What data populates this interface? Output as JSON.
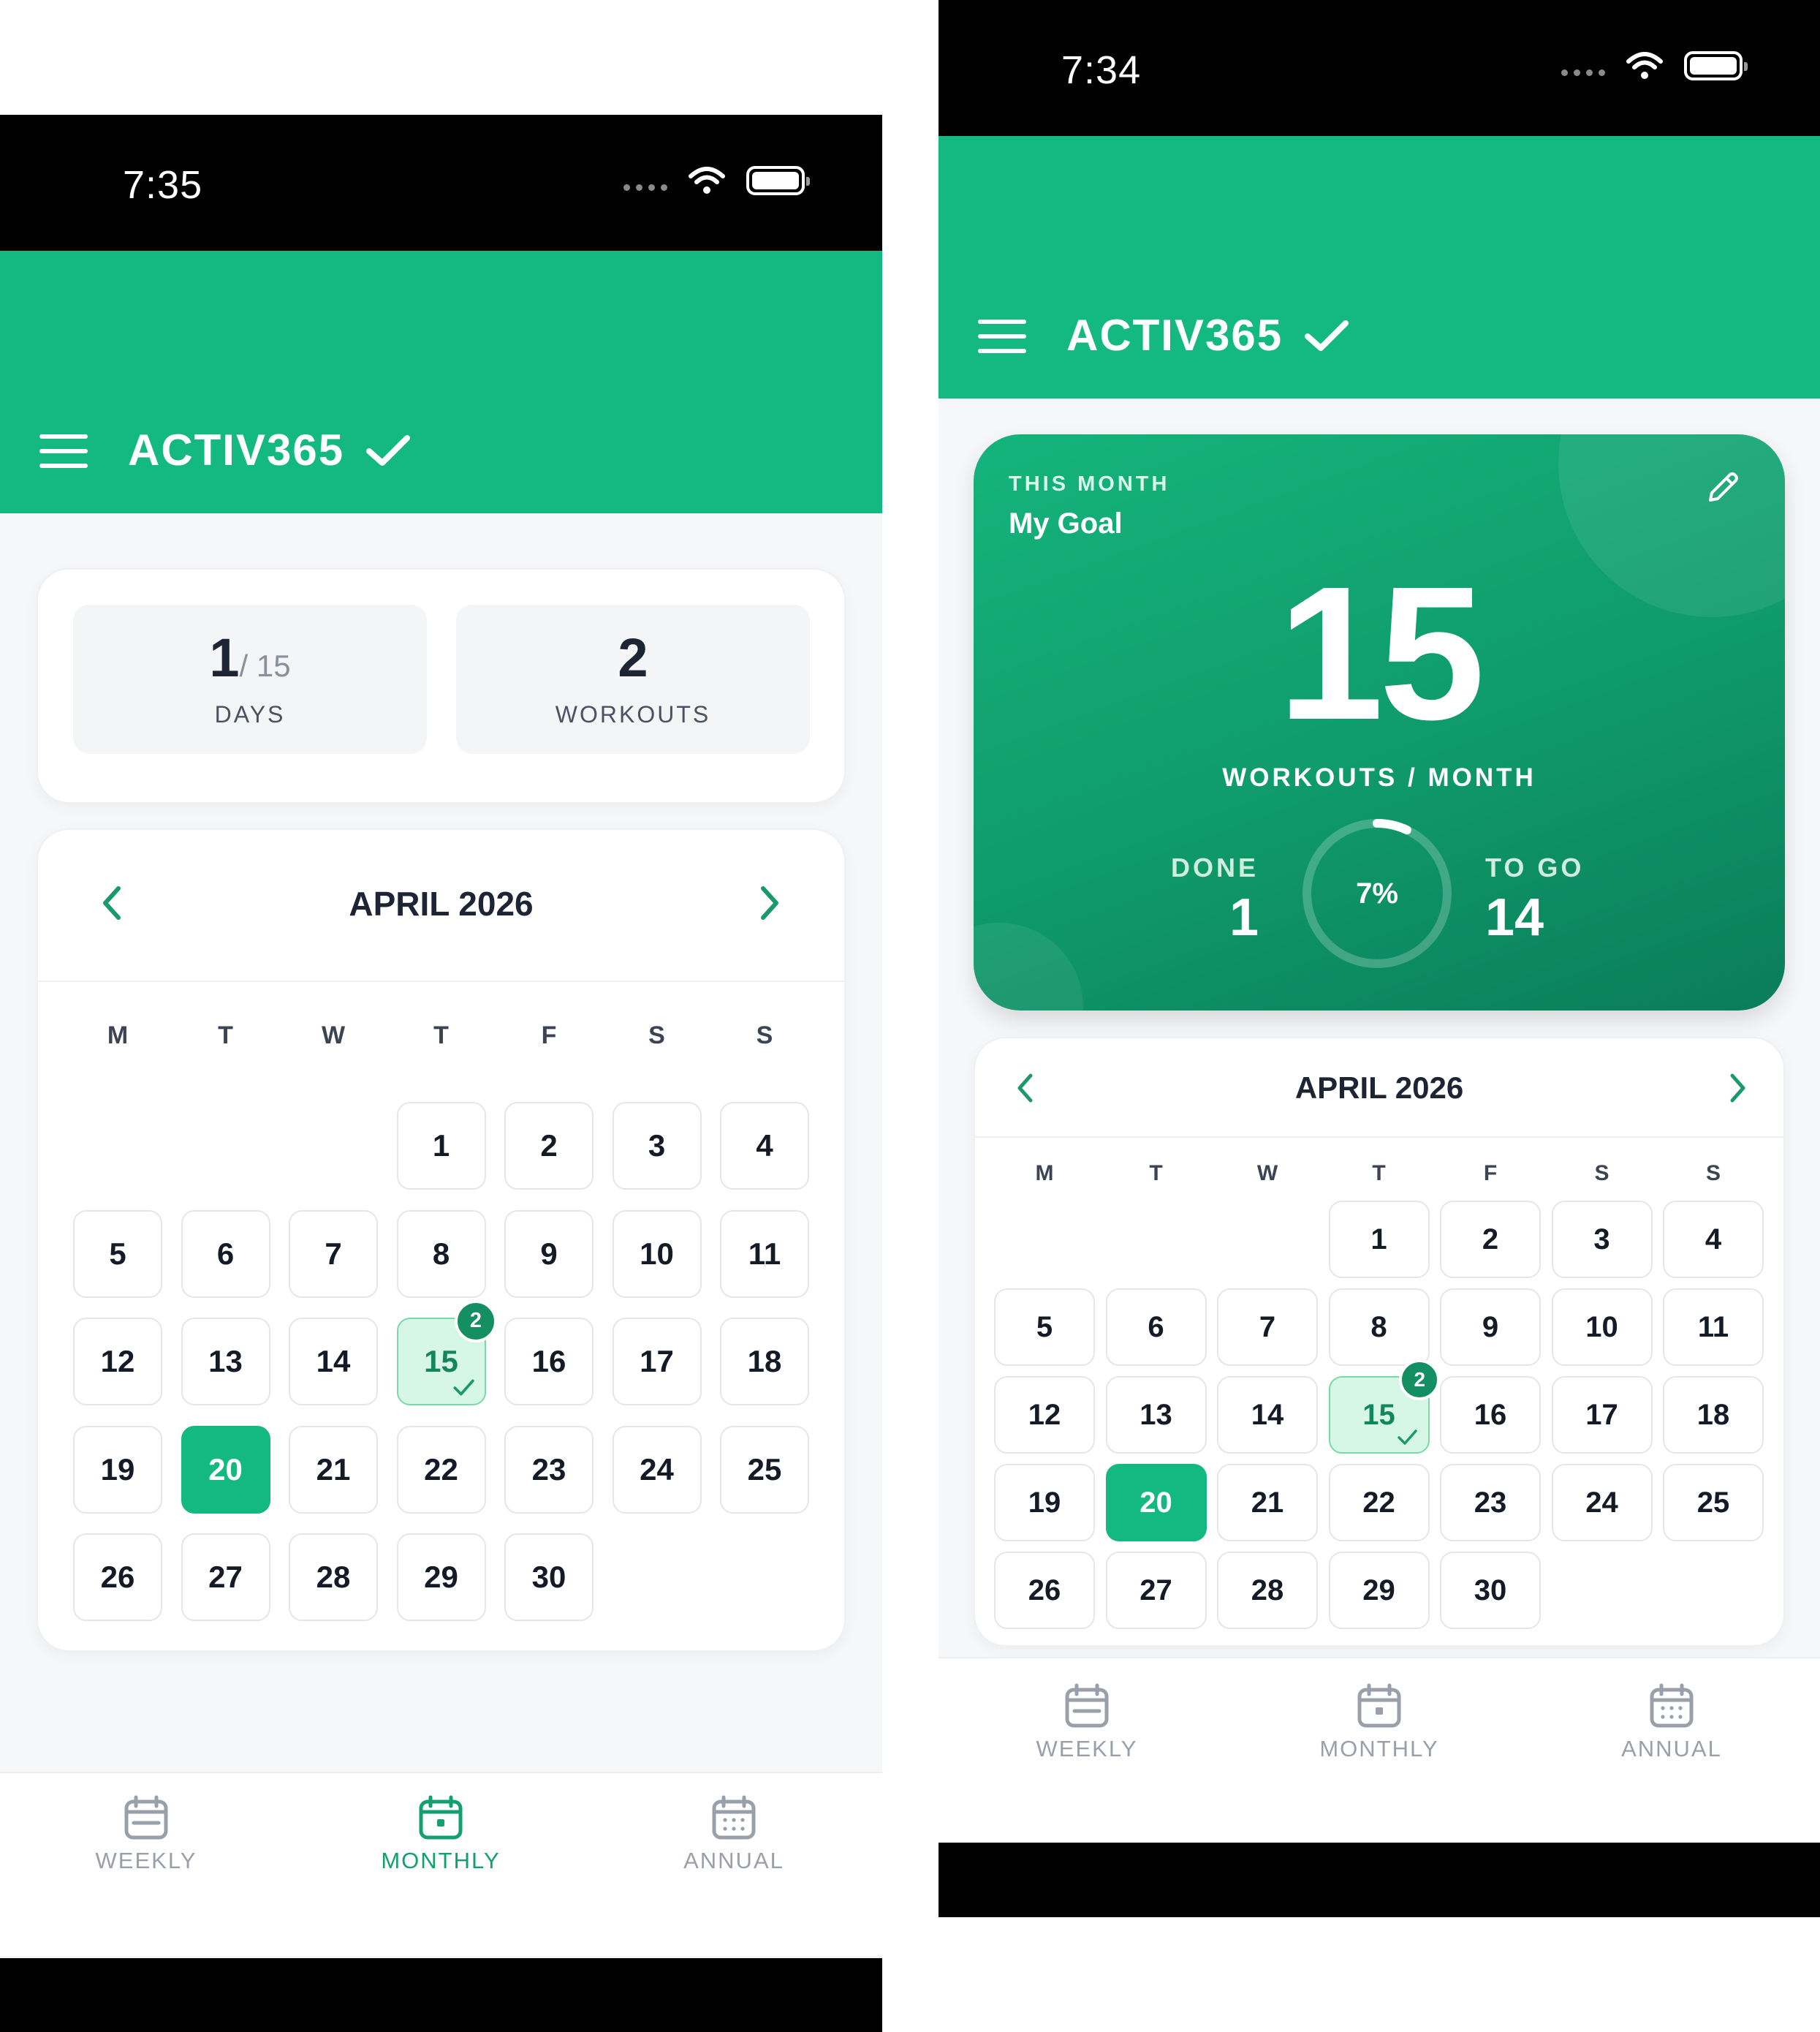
{
  "left_screen": {
    "status": {
      "time": "7:35"
    },
    "app": {
      "title": "ACTIV365"
    },
    "stats": {
      "days_value": "1",
      "days_total": "/ 15",
      "days_label": "DAYS",
      "workouts_value": "2",
      "workouts_label": "WORKOUTS"
    },
    "calendar": {
      "month": "APRIL 2026",
      "weekdays": [
        "M",
        "T",
        "W",
        "T",
        "F",
        "S",
        "S"
      ],
      "days": [
        "1",
        "2",
        "3",
        "4",
        "5",
        "6",
        "7",
        "8",
        "9",
        "10",
        "11",
        "12",
        "13",
        "14",
        "15",
        "16",
        "17",
        "18",
        "19",
        "20",
        "21",
        "22",
        "23",
        "24",
        "25",
        "26",
        "27",
        "28",
        "29",
        "30"
      ],
      "workout_day": "15",
      "workout_badge": "2",
      "today": "20"
    },
    "tabs": [
      "WEEKLY",
      "MONTHLY",
      "ANNUAL"
    ],
    "active_tab": "MONTHLY"
  },
  "right_screen": {
    "status": {
      "time": "7:34"
    },
    "app": {
      "title": "ACTIV365"
    },
    "goal": {
      "eyebrow": "THIS MONTH",
      "title": "My Goal",
      "target": "15",
      "unit": "WORKOUTS / MONTH",
      "done_label": "DONE",
      "done_value": "1",
      "progress_percent": "7%",
      "progress_fraction": 0.07,
      "togo_label": "TO GO",
      "togo_value": "14"
    },
    "calendar": {
      "month": "APRIL 2026",
      "weekdays": [
        "M",
        "T",
        "W",
        "T",
        "F",
        "S",
        "S"
      ],
      "days": [
        "1",
        "2",
        "3",
        "4",
        "5",
        "6",
        "7",
        "8",
        "9",
        "10",
        "11",
        "12",
        "13",
        "14",
        "15",
        "16",
        "17",
        "18",
        "19",
        "20",
        "21",
        "22",
        "23",
        "24",
        "25",
        "26",
        "27",
        "28",
        "29",
        "30"
      ],
      "workout_day": "15",
      "workout_badge": "2",
      "today": "20"
    },
    "tabs": [
      "WEEKLY",
      "MONTHLY",
      "ANNUAL"
    ]
  },
  "colors": {
    "brand_green": "#14b981",
    "dark_green": "#148f63",
    "workout_day_bg": "#d6f7e6"
  }
}
